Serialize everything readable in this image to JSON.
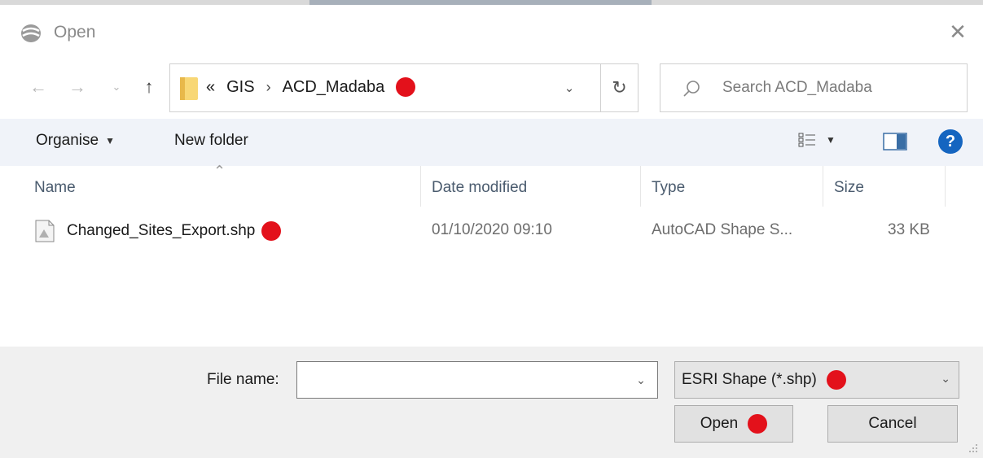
{
  "window": {
    "title": "Open",
    "close_glyph": "✕"
  },
  "nav": {
    "back_glyph": "←",
    "forward_glyph": "→",
    "recent_glyph": "⌄",
    "up_glyph": "↑",
    "breadcrumb": {
      "overflow": "«",
      "items": [
        "GIS",
        "ACD_Madaba"
      ],
      "separator": "›"
    },
    "dropdown_glyph": "⌄",
    "refresh_glyph": "↻"
  },
  "search": {
    "placeholder": "Search ACD_Madaba"
  },
  "toolbar": {
    "organise_label": "Organise",
    "organise_caret": "▼",
    "new_folder_label": "New folder",
    "view_caret": "▼",
    "help_label": "?"
  },
  "filelist": {
    "sort_glyph": "⌃",
    "columns": [
      "Name",
      "Date modified",
      "Type",
      "Size"
    ],
    "rows": [
      {
        "name": "Changed_Sites_Export.shp",
        "date_modified": "01/10/2020 09:10",
        "type": "AutoCAD Shape S...",
        "size": "33 KB"
      }
    ]
  },
  "footer": {
    "file_name_label": "File name:",
    "file_name_value": "",
    "file_name_dropdown": "⌄",
    "filter_value": "ESRI Shape (*.shp)",
    "filter_dropdown": "⌄",
    "open_label": "Open",
    "cancel_label": "Cancel"
  },
  "colors": {
    "marker_red": "#e3111b",
    "toolbar_bg": "#f0f3f9",
    "footer_bg": "#f0f0f0",
    "help_blue": "#1565c0",
    "folder_yellow": "#f8d775"
  },
  "icons": [
    "app-icon",
    "close-icon",
    "back-arrow-icon",
    "forward-arrow-icon",
    "recent-locations-icon",
    "up-arrow-icon",
    "folder-icon",
    "chevron-down-icon",
    "refresh-icon",
    "search-icon",
    "view-options-icon",
    "preview-pane-icon",
    "help-icon",
    "file-icon",
    "resize-grip-icon"
  ]
}
